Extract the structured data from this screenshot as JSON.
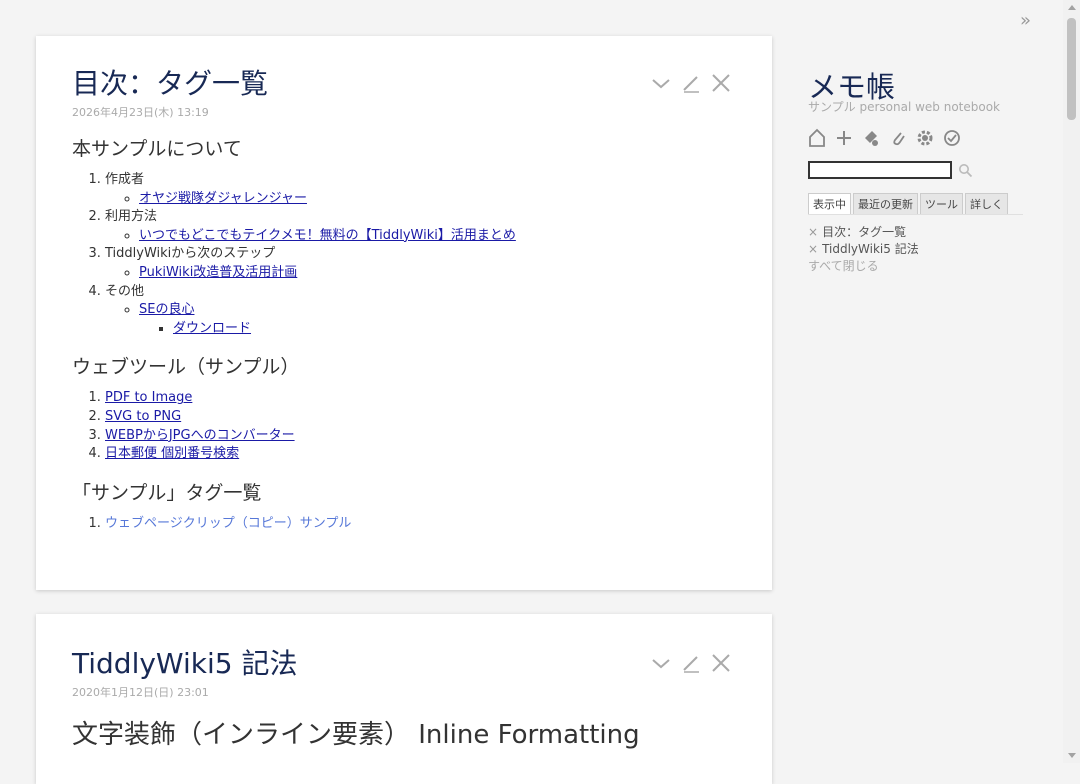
{
  "tiddler1": {
    "title": "目次：タグ一覧",
    "subtitle": "2026年4月23日(木) 13:19",
    "section1": {
      "heading": "本サンプルについて",
      "items": [
        {
          "label": "作成者",
          "sub": "オヤジ戦隊ダジャレンジャー"
        },
        {
          "label": "利用方法",
          "sub": "いつでもどこでもテイクメモ！無料の【TiddlyWiki】活用まとめ"
        },
        {
          "label": "TiddlyWikiから次のステップ",
          "sub": "PukiWiki改造普及活用計画"
        },
        {
          "label": "その他",
          "sub": "SEの良心",
          "subsub": "ダウンロード"
        }
      ]
    },
    "section2": {
      "heading": "ウェブツール（サンプル）",
      "items": [
        "PDF to Image",
        "SVG to PNG",
        "WEBPからJPGへのコンバーター",
        "日本郵便 個別番号検索"
      ]
    },
    "section3": {
      "heading": "「サンプル」タグ一覧",
      "items": [
        "ウェブページクリップ（コピー）サンプル"
      ]
    }
  },
  "tiddler2": {
    "title": "TiddlyWiki5 記法",
    "subtitle": "2020年1月12日(日) 23:01",
    "heading": "文字装飾（インライン要素） Inline Formatting"
  },
  "sidebar": {
    "title": "メモ帳",
    "subtitle": "サンプル personal web notebook",
    "search_value": "",
    "tabs": [
      "表示中",
      "最近の更新",
      "ツール",
      "詳しく"
    ],
    "open": [
      "目次：タグ一覧",
      "TiddlyWiki5 記法"
    ],
    "close_all": "すべて閉じる",
    "x_glyph": "×"
  }
}
